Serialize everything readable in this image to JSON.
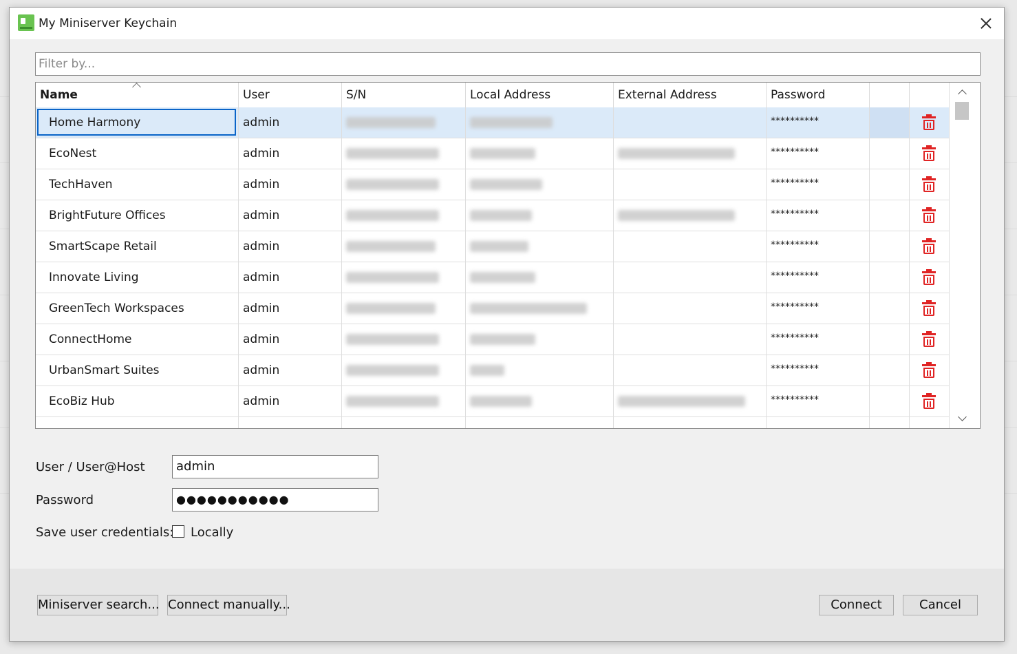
{
  "window": {
    "title": "My Miniserver Keychain",
    "icon": "loxone-config-icon"
  },
  "filter": {
    "placeholder": "Filter by..."
  },
  "table": {
    "columns": [
      "Name",
      "User",
      "S/N",
      "Local Address",
      "External Address",
      "Password"
    ],
    "sorted_column": "Name",
    "rows": [
      {
        "name": "Home Harmony",
        "user": "admin",
        "password": "**********",
        "selected": true
      },
      {
        "name": "EcoNest",
        "user": "admin",
        "password": "**********"
      },
      {
        "name": "TechHaven",
        "user": "admin",
        "password": "**********"
      },
      {
        "name": "BrightFuture Offices",
        "user": "admin",
        "password": "**********"
      },
      {
        "name": "SmartScape Retail",
        "user": "admin",
        "password": "**********"
      },
      {
        "name": "Innovate Living",
        "user": "admin",
        "password": "**********"
      },
      {
        "name": "GreenTech Workspaces",
        "user": "admin",
        "password": "**********"
      },
      {
        "name": "ConnectHome",
        "user": "admin",
        "password": "**********"
      },
      {
        "name": "UrbanSmart Suites",
        "user": "admin",
        "password": "**********"
      },
      {
        "name": "EcoBiz Hub",
        "user": "admin",
        "password": "**********"
      }
    ]
  },
  "form": {
    "user_label": "User / User@Host",
    "user_value": "admin",
    "password_label": "Password",
    "password_value": "●●●●●●●●●●●",
    "save_label": "Save user credentials:",
    "locally_label": "Locally",
    "locally_checked": false
  },
  "buttons": {
    "search": "Miniserver search...",
    "manual": "Connect manually...",
    "connect": "Connect",
    "cancel": "Cancel"
  },
  "colors": {
    "accent": "#0a64c8",
    "selection": "#dbeaf9",
    "delete": "#e02424",
    "app_icon": "#69c350"
  }
}
